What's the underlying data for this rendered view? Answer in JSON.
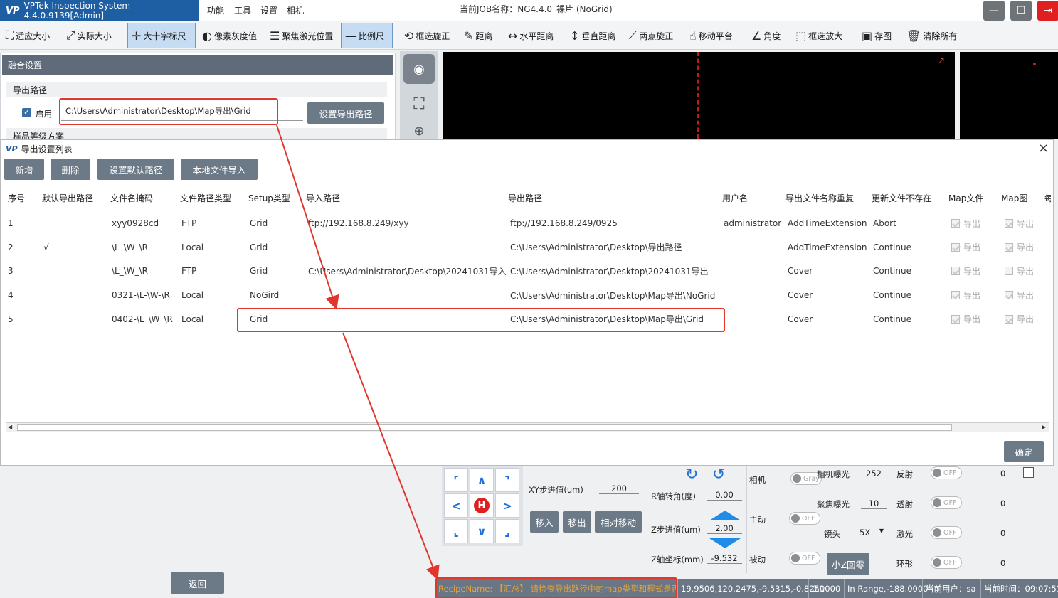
{
  "app": {
    "title": "VPTek Inspection System 4.4.0.9139[Admin]",
    "logo": "VP",
    "job_title": "当前JOB名称：NG4.4.0_裸片 (NoGrid)"
  },
  "menu": [
    "功能",
    "工具",
    "设置",
    "相机"
  ],
  "window_buttons": {
    "minimize": "—",
    "maximize": "☐",
    "exit": "⇥"
  },
  "toolbar": {
    "fit": "适应大小",
    "actual": "实际大小",
    "crosshair": "大十字标尺",
    "gray": "像素灰度值",
    "laser": "聚焦激光位置",
    "scale": "比例尺",
    "rect_rotate": "框选旋正",
    "distance": "距离",
    "hdist": "水平距离",
    "vdist": "垂直距离",
    "two_point": "两点旋正",
    "move_stage": "移动平台",
    "angle": "角度",
    "zoom_rect": "框选放大",
    "save_img": "存图",
    "clear_all": "清除所有"
  },
  "left_panel": {
    "header": "融合设置",
    "export_path_label": "导出路径",
    "enable_label": "启用",
    "path_value": "C:\\Users\\Administrator\\Desktop\\Map导出\\Grid",
    "set_path_button": "设置导出路径",
    "grade_label": "样品等级方案"
  },
  "dialog": {
    "title": "导出设置列表",
    "logo": "VP",
    "close": "×",
    "buttons": {
      "add": "新增",
      "delete": "删除",
      "set_default": "设置默认路径",
      "import_local": "本地文件导入"
    },
    "columns": [
      "序号",
      "默认导出路径",
      "文件名掩码",
      "文件路径类型",
      "Setup类型",
      "导入路径",
      "导出路径",
      "用户名",
      "导出文件名称重复",
      "更新文件不存在",
      "Map文件",
      "Map图",
      "每"
    ],
    "rows": [
      {
        "idx": "1",
        "default": "",
        "mask": "xyy0928cd",
        "ptype": "FTP",
        "setup": "Grid",
        "import": "ftp://192.168.8.249/xyy",
        "export": "ftp://192.168.8.249/0925",
        "user": "administrator",
        "dup": "AddTimeExtension",
        "missing": "Abort",
        "mapfile": "导出",
        "mapfile_on": true,
        "mapimg": "导出",
        "mapimg_on": true
      },
      {
        "idx": "2",
        "default": "√",
        "mask": "\\L_\\W_\\R",
        "ptype": "Local",
        "setup": "Grid",
        "import": "",
        "export": "C:\\Users\\Administrator\\Desktop\\导出路径",
        "user": "",
        "dup": "AddTimeExtension",
        "missing": "Continue",
        "mapfile": "导出",
        "mapfile_on": true,
        "mapimg": "导出",
        "mapimg_on": true
      },
      {
        "idx": "3",
        "default": "",
        "mask": "\\L_\\W_\\R",
        "ptype": "FTP",
        "setup": "Grid",
        "import": "C:\\Users\\Administrator\\Desktop\\20241031导入",
        "export": "C:\\Users\\Administrator\\Desktop\\20241031导出",
        "user": "",
        "dup": "Cover",
        "missing": "Continue",
        "mapfile": "导出",
        "mapfile_on": true,
        "mapimg": "导出",
        "mapimg_on": false
      },
      {
        "idx": "4",
        "default": "",
        "mask": "0321-\\L-\\W-\\R",
        "ptype": "Local",
        "setup": "NoGird",
        "import": "",
        "export": "C:\\Users\\Administrator\\Desktop\\Map导出\\NoGrid",
        "user": "",
        "dup": "Cover",
        "missing": "Continue",
        "mapfile": "导出",
        "mapfile_on": true,
        "mapimg": "导出",
        "mapimg_on": true
      },
      {
        "idx": "5",
        "default": "",
        "mask": "0402-\\L_\\W_\\R",
        "ptype": "Local",
        "setup": "Grid",
        "import": "",
        "export": "C:\\Users\\Administrator\\Desktop\\Map导出\\Grid",
        "user": "",
        "dup": "Cover",
        "missing": "Continue",
        "mapfile": "导出",
        "mapfile_on": true,
        "mapimg": "导出",
        "mapimg_on": true
      }
    ],
    "ok_button": "确定"
  },
  "controls": {
    "home": "H",
    "xy_step_label": "XY步进值(um)",
    "xy_step": "200",
    "move_in": "移入",
    "move_out": "移出",
    "relative_move": "相对移动",
    "r_angle_label": "R轴转角(度)",
    "r_angle": "0.00",
    "z_step_label": "Z步进值(um)",
    "z_step": "2.00",
    "z_coord_label": "Z轴坐标(mm)",
    "z_coord": "-9.532",
    "camera_label": "相机",
    "camera_toggle": "Gray",
    "active_label": "主动",
    "passive_label": "被动",
    "off": "OFF",
    "small_z_zero": "小Z回零",
    "cam_exposure_label": "相机曝光",
    "cam_exposure": "252",
    "focus_exposure_label": "聚焦曝光",
    "focus_exposure": "10",
    "lens_label": "镜头",
    "lens": "5X",
    "reflect_label": "反射",
    "transmit_label": "透射",
    "laser_label": "激光",
    "ring_label": "环形",
    "light_value": "0",
    "back_button": "返回"
  },
  "status": {
    "recipe": "RecipeName: 【汇总】 请检查导出路径中的map类型和程式是否",
    "coords": "19.9506,120.2475,-9.5315,-0.8251",
    "value": "0.0000",
    "range": "In Range,-188.0000",
    "user": "当前用户：sa",
    "time": "当前时间：09:07:51"
  },
  "colors": {
    "accent": "#1e5fa3",
    "annotation_red": "#e0362c",
    "status_bar": "#6a7683",
    "button": "#6c7a88"
  }
}
